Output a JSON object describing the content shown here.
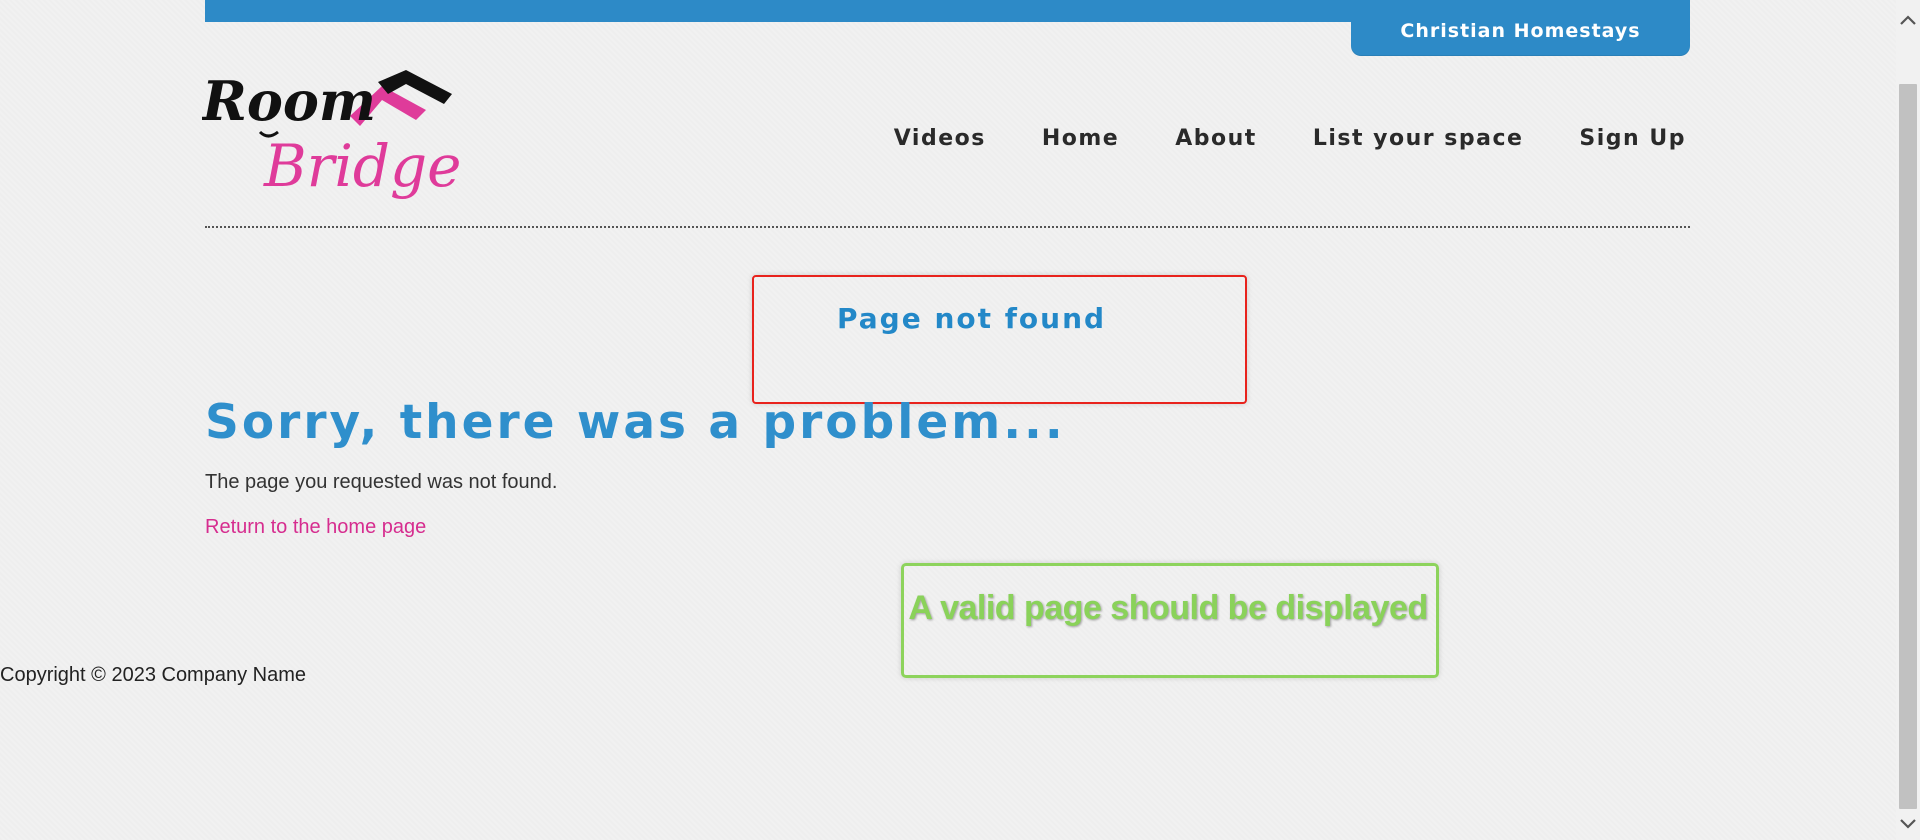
{
  "header": {
    "top_tab_label": "Christian Homestays",
    "logo": {
      "word_top": "Room",
      "word_bottom": "Bridge",
      "brand_colors": {
        "dark": "#111111",
        "pink": "#df3b9a"
      }
    }
  },
  "nav": {
    "items": [
      {
        "label": "Videos"
      },
      {
        "label": "Home"
      },
      {
        "label": "About"
      },
      {
        "label": "List your space"
      },
      {
        "label": "Sign Up"
      }
    ]
  },
  "annotations": {
    "red_box_label": "Page not found",
    "green_box_label": "A valid page should be displayed"
  },
  "main": {
    "title": "Sorry, there was a problem...",
    "message": "The page you requested was not found.",
    "home_link": "Return to the home page"
  },
  "footer": {
    "copyright": "Copyright © 2023 Company Name"
  },
  "scrollbar": {
    "up_icon": "chevron-up-icon",
    "down_icon": "chevron-down-icon"
  },
  "colors": {
    "accent_blue": "#2d8ac7",
    "link_pink": "#d62d8f",
    "annotation_red": "#e8221c",
    "annotation_green": "#8dd35c",
    "background": "#f1f1f1"
  }
}
